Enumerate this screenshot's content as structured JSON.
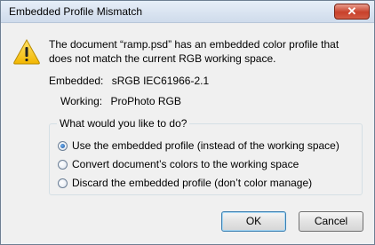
{
  "window": {
    "title": "Embedded Profile Mismatch",
    "close_label": "✕"
  },
  "icon": "warning-triangle-icon",
  "message": {
    "line1": "The document “ramp.psd” has an embedded color profile that",
    "line2": "does not match the current RGB working space."
  },
  "embedded": {
    "label": "Embedded:",
    "value": "sRGB IEC61966-2.1"
  },
  "working": {
    "label": "Working:",
    "value": "ProPhoto RGB"
  },
  "options": {
    "legend": "What would you like to do?",
    "items": [
      {
        "label": "Use the embedded profile (instead of the working space)",
        "selected": true
      },
      {
        "label": "Convert document’s colors to the working space",
        "selected": false
      },
      {
        "label": "Discard the embedded profile (don’t color manage)",
        "selected": false
      }
    ]
  },
  "buttons": {
    "ok": "OK",
    "cancel": "Cancel"
  }
}
